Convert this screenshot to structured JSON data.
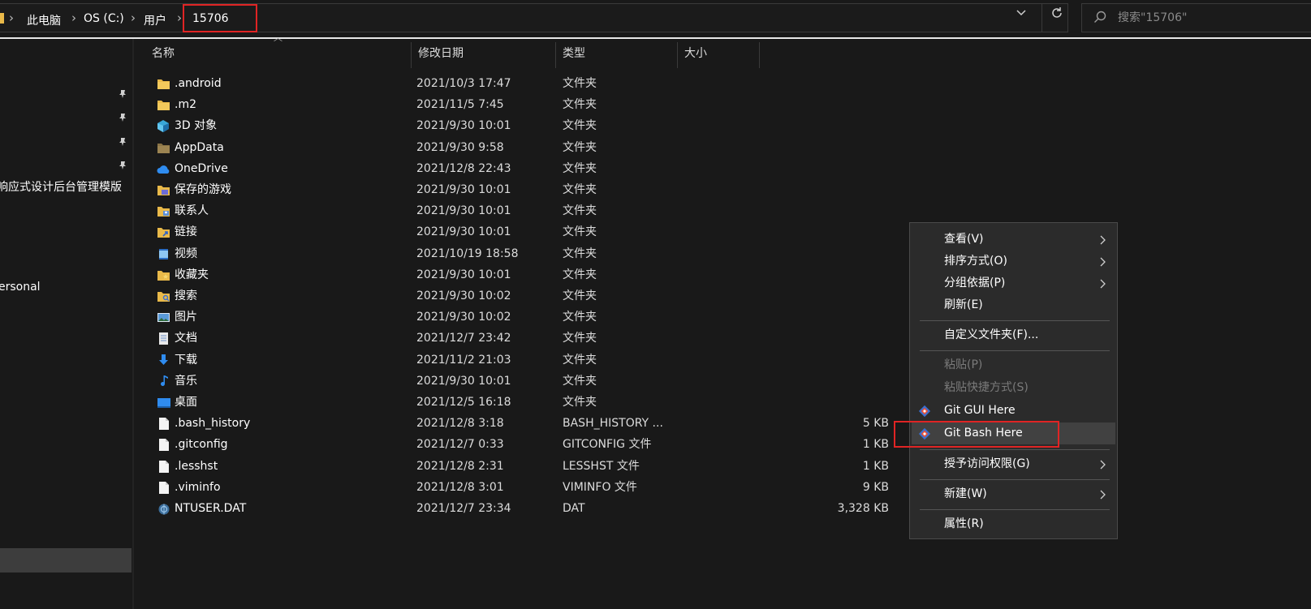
{
  "address": {
    "segments": [
      "此电脑",
      "OS (C:)",
      "用户",
      "15706"
    ],
    "search_placeholder": "搜索\"15706\""
  },
  "nav": {
    "visible_labels": [
      "响应式设计后台管理模版",
      "ersonal"
    ]
  },
  "columns": {
    "name": "名称",
    "date": "修改日期",
    "type": "类型",
    "size": "大小"
  },
  "files": [
    {
      "name": ".android",
      "date": "2021/10/3 17:47",
      "type": "文件夹",
      "size": "",
      "icon": "folder-icon"
    },
    {
      "name": ".m2",
      "date": "2021/11/5 7:45",
      "type": "文件夹",
      "size": "",
      "icon": "folder-icon"
    },
    {
      "name": "3D 对象",
      "date": "2021/9/30 10:01",
      "type": "文件夹",
      "size": "",
      "icon": "3d-objects-icon"
    },
    {
      "name": "AppData",
      "date": "2021/9/30 9:58",
      "type": "文件夹",
      "size": "",
      "icon": "hidden-folder-icon"
    },
    {
      "name": "OneDrive",
      "date": "2021/12/8 22:43",
      "type": "文件夹",
      "size": "",
      "icon": "onedrive-cloud-icon"
    },
    {
      "name": "保存的游戏",
      "date": "2021/9/30 10:01",
      "type": "文件夹",
      "size": "",
      "icon": "saved-games-folder-icon"
    },
    {
      "name": "联系人",
      "date": "2021/9/30 10:01",
      "type": "文件夹",
      "size": "",
      "icon": "contacts-folder-icon"
    },
    {
      "name": "链接",
      "date": "2021/9/30 10:01",
      "type": "文件夹",
      "size": "",
      "icon": "links-folder-icon"
    },
    {
      "name": "视频",
      "date": "2021/10/19 18:58",
      "type": "文件夹",
      "size": "",
      "icon": "videos-folder-icon"
    },
    {
      "name": "收藏夹",
      "date": "2021/9/30 10:01",
      "type": "文件夹",
      "size": "",
      "icon": "favorites-folder-icon"
    },
    {
      "name": "搜索",
      "date": "2021/9/30 10:02",
      "type": "文件夹",
      "size": "",
      "icon": "searches-folder-icon"
    },
    {
      "name": "图片",
      "date": "2021/9/30 10:02",
      "type": "文件夹",
      "size": "",
      "icon": "pictures-folder-icon"
    },
    {
      "name": "文档",
      "date": "2021/12/7 23:42",
      "type": "文件夹",
      "size": "",
      "icon": "documents-folder-icon"
    },
    {
      "name": "下载",
      "date": "2021/11/2 21:03",
      "type": "文件夹",
      "size": "",
      "icon": "downloads-folder-icon"
    },
    {
      "name": "音乐",
      "date": "2021/9/30 10:01",
      "type": "文件夹",
      "size": "",
      "icon": "music-folder-icon"
    },
    {
      "name": "桌面",
      "date": "2021/12/5 16:18",
      "type": "文件夹",
      "size": "",
      "icon": "desktop-folder-icon"
    },
    {
      "name": ".bash_history",
      "date": "2021/12/8 3:18",
      "type": "BASH_HISTORY ...",
      "size": "5 KB",
      "icon": "file-icon"
    },
    {
      "name": ".gitconfig",
      "date": "2021/12/7 0:33",
      "type": "GITCONFIG 文件",
      "size": "1 KB",
      "icon": "file-icon"
    },
    {
      "name": ".lesshst",
      "date": "2021/12/8 2:31",
      "type": "LESSHST 文件",
      "size": "1 KB",
      "icon": "file-icon"
    },
    {
      "name": ".viminfo",
      "date": "2021/12/8 3:01",
      "type": "VIMINFO 文件",
      "size": "9 KB",
      "icon": "file-icon"
    },
    {
      "name": "NTUSER.DAT",
      "date": "2021/12/7 23:34",
      "type": "DAT",
      "size": "3,328 KB",
      "icon": "system-file-icon"
    }
  ],
  "context_menu": {
    "view": "查看(V)",
    "sort_by": "排序方式(O)",
    "group_by": "分组依据(P)",
    "refresh": "刷新(E)",
    "customize_folder": "自定义文件夹(F)...",
    "paste": "粘贴(P)",
    "paste_shortcut": "粘贴快捷方式(S)",
    "git_gui": "Git GUI Here",
    "git_bash": "Git Bash Here",
    "give_access": "授予访问权限(G)",
    "new": "新建(W)",
    "properties": "属性(R)"
  },
  "colors": {
    "background": "#191919",
    "menu_background": "#2b2b2b",
    "highlight_box": "#e02424",
    "folder_yellow": "#e9b949"
  }
}
